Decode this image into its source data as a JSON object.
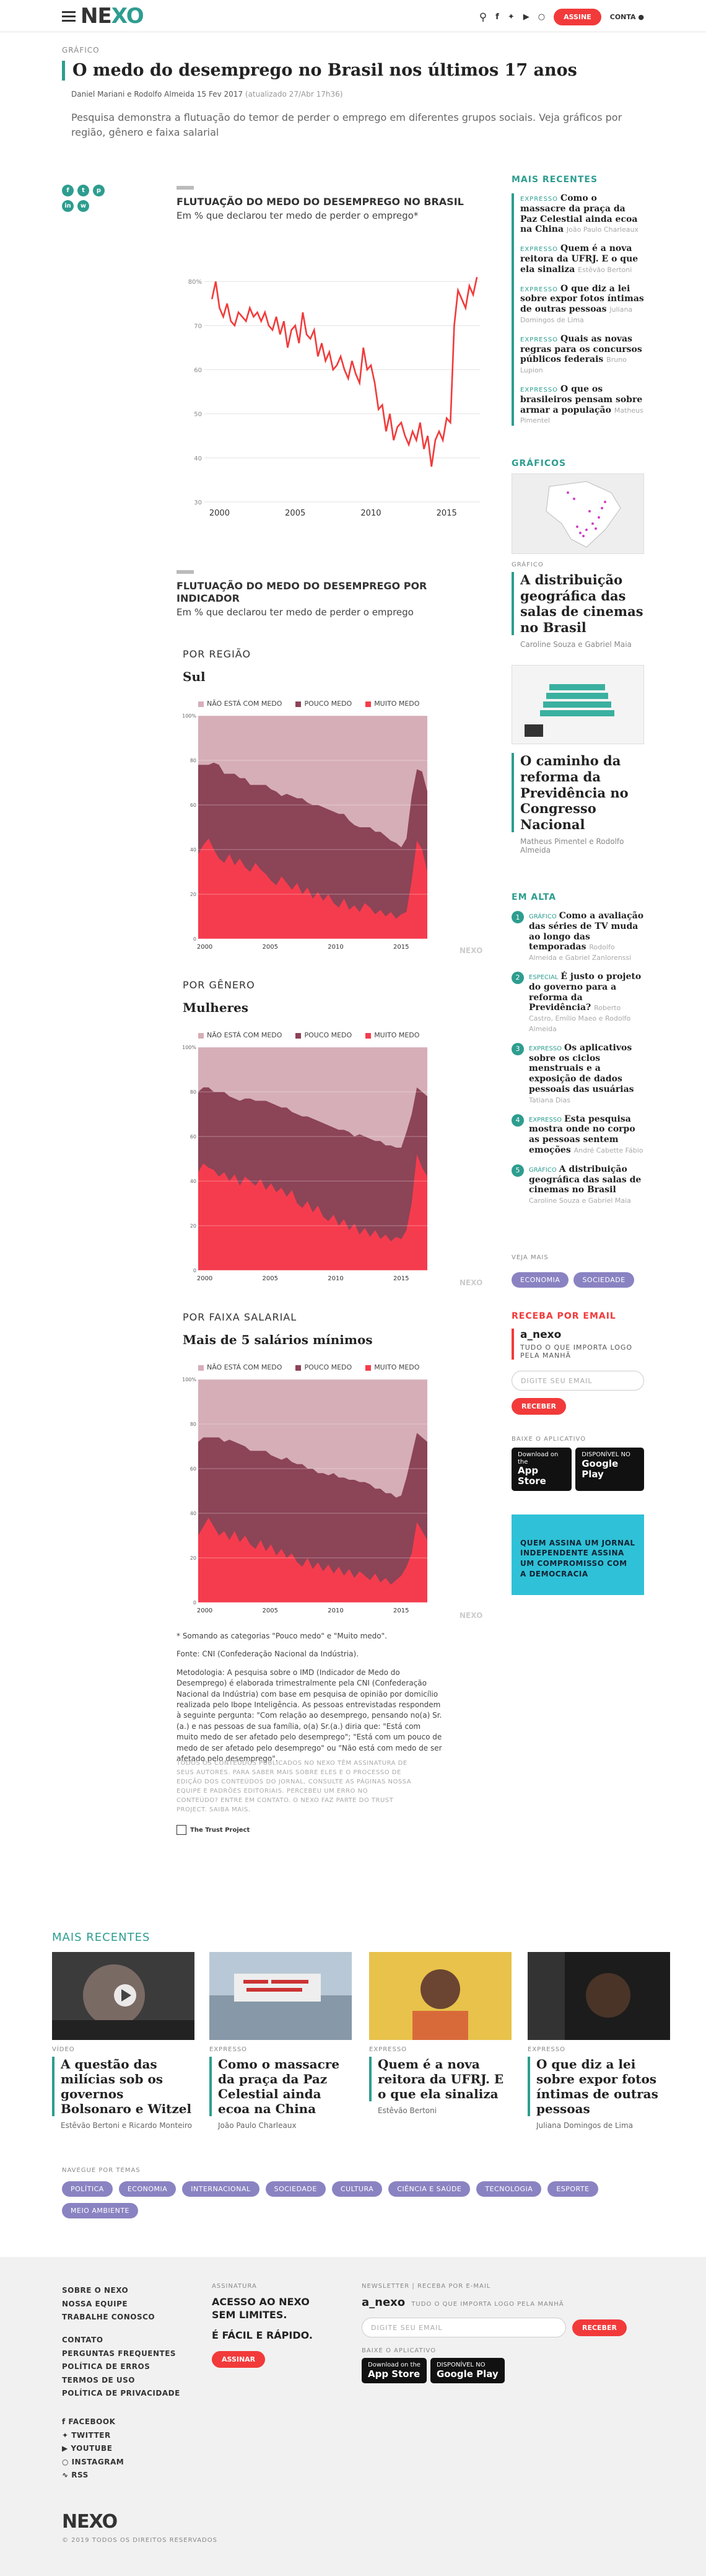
{
  "header": {
    "logo_a": "NE",
    "logo_b": "XO",
    "assine": "ASSINE",
    "conta": "CONTA"
  },
  "article": {
    "category": "GRÁFICO",
    "title": "O medo do desemprego no Brasil nos últimos 17 anos",
    "byline": "Daniel Mariani e Rodolfo Almeida 15 Fev 2017",
    "updated": "(atualizado 27/Abr 17h36)",
    "lead": "Pesquisa demonstra a flutuação do temor de perder o emprego em diferentes grupos sociais. Veja gráficos por região, gênero e faixa salarial"
  },
  "chart1": {
    "title": "FLUTUAÇÃO DO MEDO DO DESEMPREGO NO BRASIL",
    "subtitle": "Em % que declarou ter medo de perder o emprego*"
  },
  "chart2": {
    "title": "FLUTUAÇÃO DO MEDO DO DESEMPREGO POR INDICADOR",
    "subtitle": "Em % que declarou ter medo de perder o emprego"
  },
  "sections": [
    {
      "label": "POR REGIÃO",
      "sub": "Sul"
    },
    {
      "label": "POR GÊNERO",
      "sub": "Mulheres"
    },
    {
      "label": "POR FAIXA SALARIAL",
      "sub": "Mais de 5 salários mínimos"
    }
  ],
  "legend": [
    "NÃO ESTÁ COM MEDO",
    "POUCO MEDO",
    "MUITO MEDO"
  ],
  "watermark": "NEXO",
  "chart_data": [
    {
      "type": "line",
      "title": "FLUTUAÇÃO DO MEDO DO DESEMPREGO NO BRASIL",
      "xlabel": "",
      "ylabel": "Em % que declarou ter medo de perder o emprego*",
      "xticks": [
        2000,
        2005,
        2010,
        2015
      ],
      "yticks": [
        "30",
        "40",
        "50",
        "60",
        "70",
        "80%"
      ],
      "ylim": [
        30,
        82
      ],
      "xlim": [
        1999.0,
        2017.2
      ],
      "x": [
        1999.5,
        1999.75,
        2000,
        2000.25,
        2000.5,
        2000.75,
        2001,
        2001.25,
        2001.5,
        2001.75,
        2002,
        2002.25,
        2002.5,
        2002.75,
        2003,
        2003.25,
        2003.5,
        2003.75,
        2004,
        2004.25,
        2004.5,
        2004.75,
        2005,
        2005.25,
        2005.5,
        2005.75,
        2006,
        2006.25,
        2006.5,
        2006.75,
        2007,
        2007.25,
        2007.5,
        2007.75,
        2008,
        2008.25,
        2008.5,
        2008.75,
        2009,
        2009.25,
        2009.5,
        2009.75,
        2010,
        2010.25,
        2010.5,
        2010.75,
        2011,
        2011.25,
        2011.5,
        2011.75,
        2012,
        2012.25,
        2012.5,
        2012.75,
        2013,
        2013.25,
        2013.5,
        2013.75,
        2014,
        2014.25,
        2014.5,
        2014.75,
        2015,
        2015.25,
        2015.5,
        2015.75,
        2016,
        2016.25,
        2016.5,
        2016.75,
        2017
      ],
      "values": [
        76,
        80,
        74,
        72,
        75,
        71,
        70,
        73,
        72,
        71,
        74,
        72,
        73,
        71,
        73,
        70,
        69,
        72,
        68,
        71,
        65,
        69,
        70,
        66,
        73,
        68,
        67,
        69,
        63,
        66,
        62,
        64,
        60,
        61,
        63,
        60,
        58,
        62,
        59,
        57,
        65,
        60,
        61,
        57,
        51,
        52,
        46,
        50,
        44,
        47,
        48,
        45,
        43,
        46,
        44,
        48,
        42,
        45,
        38,
        44,
        46,
        44,
        49,
        48,
        70,
        78,
        76,
        74,
        79,
        77,
        81
      ]
    },
    {
      "type": "area",
      "title": "Sul",
      "categories_start": 1999.5,
      "categories_end": 2017.0,
      "xticks": [
        2000,
        2005,
        2010,
        2015
      ],
      "yticks": [
        "0",
        "20",
        "40",
        "60",
        "80",
        "100%"
      ],
      "ylim": [
        0,
        100
      ],
      "series": [
        {
          "name": "MUITO MEDO",
          "values": [
            38,
            42,
            45,
            40,
            36,
            34,
            38,
            33,
            36,
            32,
            30,
            34,
            31,
            29,
            26,
            24,
            28,
            25,
            22,
            25,
            20,
            23,
            18,
            21,
            17,
            20,
            16,
            14,
            18,
            13,
            15,
            12,
            16,
            14,
            11,
            13,
            10,
            12,
            9,
            11,
            12,
            26,
            44,
            40,
            30
          ]
        },
        {
          "name": "POUCO MEDO",
          "values": [
            40,
            36,
            33,
            39,
            42,
            40,
            36,
            41,
            36,
            40,
            39,
            35,
            38,
            40,
            41,
            42,
            36,
            40,
            42,
            38,
            43,
            38,
            42,
            39,
            42,
            38,
            41,
            42,
            38,
            40,
            36,
            38,
            34,
            36,
            37,
            35,
            36,
            32,
            34,
            30,
            33,
            38,
            32,
            35,
            36
          ]
        }
      ]
    },
    {
      "type": "area",
      "title": "Mulheres",
      "categories_start": 1999.5,
      "categories_end": 2017.0,
      "xticks": [
        2000,
        2005,
        2010,
        2015
      ],
      "yticks": [
        "0",
        "20",
        "40",
        "60",
        "80",
        "100%"
      ],
      "ylim": [
        0,
        100
      ],
      "series": [
        {
          "name": "MUITO MEDO",
          "values": [
            44,
            48,
            46,
            45,
            42,
            44,
            40,
            43,
            38,
            42,
            40,
            38,
            41,
            36,
            39,
            35,
            37,
            33,
            36,
            30,
            28,
            31,
            26,
            29,
            24,
            22,
            25,
            20,
            23,
            18,
            21,
            16,
            19,
            15,
            18,
            14,
            16,
            13,
            15,
            14,
            18,
            30,
            52,
            46,
            42
          ]
        },
        {
          "name": "POUCO MEDO",
          "values": [
            36,
            34,
            36,
            35,
            38,
            36,
            38,
            34,
            38,
            35,
            37,
            38,
            35,
            40,
            36,
            39,
            36,
            40,
            35,
            40,
            41,
            38,
            42,
            38,
            42,
            43,
            39,
            43,
            40,
            44,
            39,
            45,
            41,
            44,
            40,
            44,
            40,
            43,
            40,
            41,
            44,
            40,
            30,
            34,
            36
          ]
        }
      ]
    },
    {
      "type": "area",
      "title": "Mais de 5 salários mínimos",
      "categories_start": 1999.5,
      "categories_end": 2017.0,
      "xticks": [
        2000,
        2005,
        2010,
        2015
      ],
      "yticks": [
        "0",
        "20",
        "40",
        "60",
        "80",
        "100%"
      ],
      "ylim": [
        0,
        100
      ],
      "series": [
        {
          "name": "MUITO MEDO",
          "values": [
            30,
            34,
            38,
            34,
            30,
            32,
            28,
            32,
            27,
            30,
            26,
            24,
            28,
            23,
            26,
            21,
            24,
            20,
            22,
            18,
            16,
            20,
            15,
            18,
            14,
            17,
            13,
            16,
            12,
            15,
            11,
            14,
            12,
            10,
            13,
            9,
            11,
            8,
            10,
            12,
            16,
            22,
            36,
            32,
            28
          ]
        },
        {
          "name": "POUCO MEDO",
          "values": [
            42,
            40,
            36,
            40,
            44,
            40,
            45,
            40,
            44,
            40,
            42,
            44,
            40,
            45,
            40,
            44,
            40,
            45,
            41,
            44,
            46,
            40,
            45,
            40,
            44,
            40,
            45,
            40,
            44,
            40,
            44,
            40,
            42,
            43,
            38,
            42,
            38,
            41,
            37,
            36,
            40,
            44,
            40,
            42,
            44
          ]
        }
      ]
    }
  ],
  "colors": {
    "teal": "#2d9d8f",
    "red": "#f23a3a",
    "muito": "#f53c4e",
    "pouco": "#8c4457",
    "nao": "#d6aeb8"
  },
  "notes": {
    "n1": "* Somando as categorias \"Pouco medo\" e \"Muito medo\".",
    "n2": "Fonte: CNI (Confederação Nacional da Indústria).",
    "n3": "Metodologia: A pesquisa sobre o IMD (Indicador de Medo do Desemprego) é elaborada trimestralmente pela CNI (Confederação Nacional da Indústria) com base em pesquisa de opinião por domicílio realizada pelo Ibope Inteligência. As pessoas entrevistadas respondem à seguinte pergunta: \"Com relação ao desemprego, pensando no(a) Sr.(a.) e nas pessoas de sua família, o(a) Sr.(a.) diria que: \"Está com muito medo de ser afetado pelo desemprego\"; \"Está com um pouco de medo de ser afetado pelo desemprego\" ou \"Não está com medo de ser afetado pelo desemprego\".",
    "fine": "TODOS OS CONTEÚDOS PUBLICADOS NO NEXO TÊM ASSINATURA DE SEUS AUTORES. PARA SABER MAIS SOBRE ELES E O PROCESSO DE EDIÇÃO DOS CONTEÚDOS DO JORNAL, CONSULTE AS PÁGINAS NOSSA EQUIPE E PADRÕES EDITORIAIS. PERCEBEU UM ERRO NO CONTEÚDO? ENTRE EM CONTATO. O NEXO FAZ PARTE DO TRUST PROJECT. SAIBA MAIS.",
    "trust": "The Trust Project"
  },
  "sidebar": {
    "mais_recentes": "MAIS RECENTES",
    "recentes": [
      {
        "k": "EXPRESSO",
        "t": "Como o massacre da praça da Paz Celestial ainda ecoa na China",
        "a": "João Paulo Charleaux"
      },
      {
        "k": "EXPRESSO",
        "t": "Quem é a nova reitora da UFRJ. E o que ela sinaliza",
        "a": "Estêvão Bertoni"
      },
      {
        "k": "EXPRESSO",
        "t": "O que diz a lei sobre expor fotos íntimas de outras pessoas",
        "a": "Juliana Domingos de Lima"
      },
      {
        "k": "EXPRESSO",
        "t": "Quais as novas regras para os concursos públicos federais",
        "a": "Bruno Lupion"
      },
      {
        "k": "EXPRESSO",
        "t": "O que os brasileiros pensam sobre armar a população",
        "a": "Matheus Pimentel"
      }
    ],
    "graficos": "GRÁFICOS",
    "g1": {
      "cat": "GRÁFICO",
      "t": "A distribuição geográfica das salas de cinemas no Brasil",
      "a": "Caroline Souza e Gabriel Maia"
    },
    "g2": {
      "t": "O caminho da reforma da Previdência no Congresso Nacional",
      "a": "Matheus Pimentel e Rodolfo Almeida"
    },
    "em_alta": "EM ALTA",
    "alta": [
      {
        "n": "1",
        "k": "GRÁFICO",
        "t": "Como a avaliação das séries de TV muda ao longo das temporadas",
        "a": "Rodolfo Almeida e Gabriel Zanlorenssi"
      },
      {
        "n": "2",
        "k": "ESPECIAL",
        "t": "É justo o projeto do governo para a reforma da Previdência?",
        "a": "Roberto Castro, Emílio Maeo e Rodolfo Almeida"
      },
      {
        "n": "3",
        "k": "EXPRESSO",
        "t": "Os aplicativos sobre os ciclos menstruais e a exposição de dados pessoais das usuárias",
        "a": "Tatiana Dias"
      },
      {
        "n": "4",
        "k": "EXPRESSO",
        "t": "Esta pesquisa mostra onde no corpo as pessoas sentem emoções",
        "a": "André Cabette Fábio"
      },
      {
        "n": "5",
        "k": "GRÁFICO",
        "t": "A distribuição geográfica das salas de cinemas no Brasil",
        "a": "Caroline Souza e Gabriel Maia"
      }
    ],
    "veja_mais": "VEJA MAIS",
    "veja_pills": [
      "ECONOMIA",
      "SOCIEDADE"
    ],
    "receba": "RECEBA POR EMAIL",
    "anexo": "a_nexo",
    "anexo_sub": "TUDO O QUE IMPORTA LOGO PELA MANHÃ",
    "email_ph": "DIGITE SEU EMAIL",
    "receber": "RECEBER",
    "baixe": "BAIXE O APLICATIVO",
    "appstore": "App Store",
    "appstore_small": "Download on the",
    "gplay": "Google Play",
    "gplay_small": "DISPONÍVEL NO",
    "cta": "QUEM ASSINA UM JORNAL INDEPENDENTE ASSINA UM COMPROMISSO COM A DEMOCRACIA"
  },
  "bottom": {
    "title": "MAIS RECENTES",
    "cards": [
      {
        "cat": "VÍDEO",
        "t": "A questão das milícias sob os governos Bolsonaro e Witzel",
        "a": "Estêvão Bertoni e Ricardo Monteiro"
      },
      {
        "cat": "EXPRESSO",
        "t": "Como o massacre da praça da Paz Celestial ainda ecoa na China",
        "a": "João Paulo Charleaux"
      },
      {
        "cat": "EXPRESSO",
        "t": "Quem é a nova reitora da UFRJ. E o que ela sinaliza",
        "a": "Estêvão Bertoni"
      },
      {
        "cat": "EXPRESSO",
        "t": "O que diz a lei sobre expor fotos íntimas de outras pessoas",
        "a": "Juliana Domingos de Lima"
      }
    ],
    "navegue": "NAVEGUE POR TEMAS",
    "temas": [
      "POLÍTICA",
      "ECONOMIA",
      "INTERNACIONAL",
      "SOCIEDADE",
      "CULTURA",
      "CIÊNCIA E SAÚDE",
      "TECNOLOGIA",
      "ESPORTE",
      "MEIO AMBIENTE"
    ]
  },
  "footer": {
    "links1": [
      "SOBRE O NEXO",
      "NOSSA EQUIPE",
      "TRABALHE CONOSCO"
    ],
    "links2": [
      "CONTATO",
      "PERGUNTAS FREQUENTES",
      "POLÍTICA DE ERROS",
      "TERMOS DE USO",
      "POLÍTICA DE PRIVACIDADE"
    ],
    "social": [
      "FACEBOOK",
      "TWITTER",
      "YOUTUBE",
      "INSTAGRAM",
      "RSS"
    ],
    "assinatura": "ASSINATURA",
    "acesso": "ACESSO AO NEXO SEM LIMITES.",
    "facil": "É FÁCIL E RÁPIDO.",
    "assinar": "ASSINAR",
    "newsletter": "NEWSLETTER | RECEBA POR E-MAIL",
    "anexo": "a_nexo",
    "anexo_sub": "TUDO O QUE IMPORTA LOGO PELA MANHÃ",
    "email_ph": "DIGITE SEU EMAIL",
    "receber": "RECEBER",
    "baixe": "BAIXE O APLICATIVO",
    "copyright": "© 2019 TODOS OS DIREITOS RESERVADOS",
    "logo": "NEXO"
  }
}
